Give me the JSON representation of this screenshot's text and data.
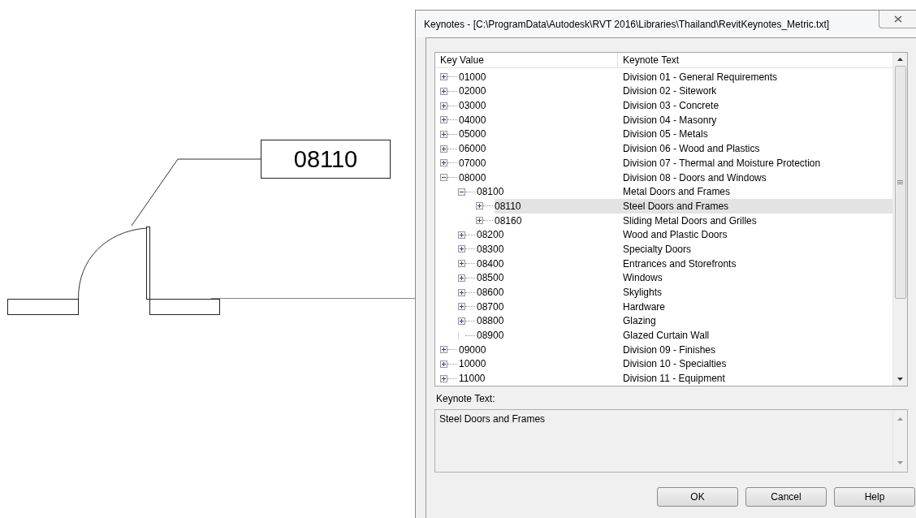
{
  "drawing": {
    "tag": "08110"
  },
  "window": {
    "title": "Keynotes - [C:\\ProgramData\\Autodesk\\RVT 2016\\Libraries\\Thailand\\RevitKeynotes_Metric.txt]"
  },
  "table": {
    "columns": [
      "Key Value",
      "Keynote Text"
    ],
    "rows": [
      {
        "key": "01000",
        "text": "Division 01 - General Requirements",
        "kind": "node",
        "expanded": false,
        "selected": false
      },
      {
        "key": "02000",
        "text": "Division 02 - Sitework",
        "kind": "node",
        "expanded": false,
        "selected": false
      },
      {
        "key": "03000",
        "text": "Division 03 - Concrete",
        "kind": "node",
        "expanded": false,
        "selected": false
      },
      {
        "key": "04000",
        "text": "Division 04 - Masonry",
        "kind": "node",
        "expanded": false,
        "selected": false
      },
      {
        "key": "05000",
        "text": "Division 05 - Metals",
        "kind": "node",
        "expanded": false,
        "selected": false
      },
      {
        "key": "06000",
        "text": "Division 06 - Wood and Plastics",
        "kind": "node",
        "expanded": false,
        "selected": false
      },
      {
        "key": "07000",
        "text": "Division 07 - Thermal and Moisture Protection",
        "kind": "node",
        "expanded": false,
        "selected": false
      },
      {
        "key": "08000",
        "text": "Division 08 - Doors and Windows",
        "kind": "node",
        "expanded": true,
        "selected": false,
        "children": [
          {
            "key": "08100",
            "text": "Metal Doors and Frames",
            "kind": "node",
            "expanded": true,
            "selected": false,
            "children": [
              {
                "key": "08110",
                "text": "Steel Doors and Frames",
                "kind": "node",
                "expanded": false,
                "selected": true
              },
              {
                "key": "08160",
                "text": "Sliding Metal Doors and Grilles",
                "kind": "node",
                "expanded": false,
                "selected": false
              }
            ]
          },
          {
            "key": "08200",
            "text": "Wood and Plastic Doors",
            "kind": "node",
            "expanded": false,
            "selected": false
          },
          {
            "key": "08300",
            "text": "Specialty Doors",
            "kind": "node",
            "expanded": false,
            "selected": false
          },
          {
            "key": "08400",
            "text": "Entrances and Storefronts",
            "kind": "node",
            "expanded": false,
            "selected": false
          },
          {
            "key": "08500",
            "text": "Windows",
            "kind": "node",
            "expanded": false,
            "selected": false
          },
          {
            "key": "08600",
            "text": "Skylights",
            "kind": "node",
            "expanded": false,
            "selected": false
          },
          {
            "key": "08700",
            "text": "Hardware",
            "kind": "node",
            "expanded": false,
            "selected": false
          },
          {
            "key": "08800",
            "text": "Glazing",
            "kind": "node",
            "expanded": false,
            "selected": false
          },
          {
            "key": "08900",
            "text": "Glazed Curtain Wall",
            "kind": "leaf",
            "selected": false
          }
        ]
      },
      {
        "key": "09000",
        "text": "Division 09 - Finishes",
        "kind": "node",
        "expanded": false,
        "selected": false
      },
      {
        "key": "10000",
        "text": "Division 10 - Specialties",
        "kind": "node",
        "expanded": false,
        "selected": false
      },
      {
        "key": "11000",
        "text": "Division 11 - Equipment",
        "kind": "node",
        "expanded": false,
        "selected": false
      }
    ]
  },
  "detail": {
    "label": "Keynote Text:",
    "value": "Steel Doors and Frames"
  },
  "buttons": [
    "OK",
    "Cancel",
    "Help"
  ]
}
